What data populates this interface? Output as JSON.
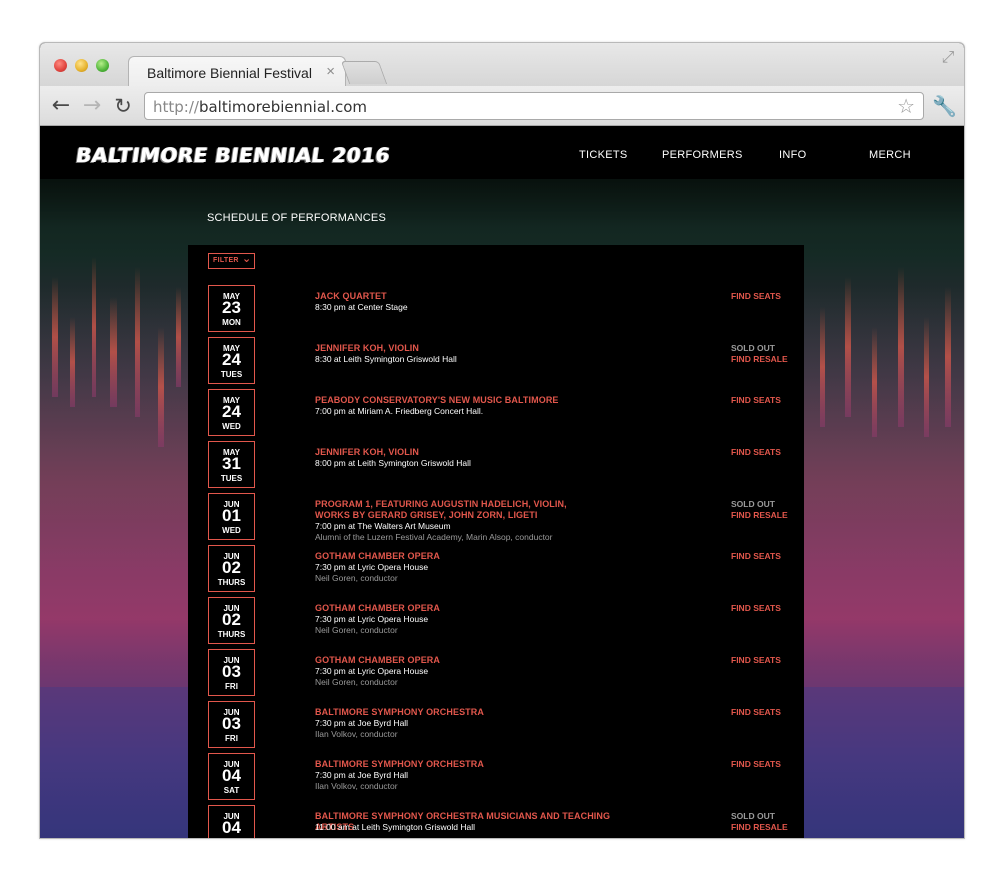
{
  "browser": {
    "tab_title": "Baltimore Biennial Festival",
    "tab_close": "×",
    "url_protocol": "http://",
    "url_host": "baltimorebiennial.com",
    "icons": {
      "back": "←",
      "forward": "→",
      "reload": "↻",
      "star": "☆",
      "wrench": "🔧",
      "resize": "⤢"
    }
  },
  "site": {
    "logo": "BALTIMORE BIENNIAL 2016",
    "nav": [
      "TICKETS",
      "PERFORMERS",
      "INFO",
      "MERCH"
    ],
    "section_title": "SCHEDULE OF PERFORMANCES",
    "filter_label": "FILTER",
    "filter_icon": "⌄"
  },
  "colors": {
    "accent": "#e2574c",
    "muted": "#9a9a9a",
    "background": "#000000"
  },
  "events": [
    {
      "month": "MAY",
      "day": "23",
      "weekday": "MON",
      "title_lines": [
        "JACK QUARTET"
      ],
      "detail": "8:30 pm at Center Stage",
      "conductor": "",
      "status": "",
      "action": "FIND SEATS"
    },
    {
      "month": "MAY",
      "day": "24",
      "weekday": "TUES",
      "title_lines": [
        "JENNIFER KOH, VIOLIN"
      ],
      "detail": "8:30 at Leith Symington Griswold Hall",
      "conductor": "",
      "status": "SOLD OUT",
      "action": "FIND RESALE"
    },
    {
      "month": "MAY",
      "day": "24",
      "weekday": "WED",
      "title_lines": [
        "PEABODY CONSERVATORY'S NEW MUSIC BALTIMORE"
      ],
      "detail": "7:00 pm at Miriam A. Friedberg Concert Hall.",
      "conductor": "",
      "status": "",
      "action": "FIND SEATS"
    },
    {
      "month": "MAY",
      "day": "31",
      "weekday": "TUES",
      "title_lines": [
        "JENNIFER KOH, VIOLIN"
      ],
      "detail": "8:00 pm at Leith Symington Griswold Hall",
      "conductor": "",
      "status": "",
      "action": "FIND SEATS"
    },
    {
      "month": "JUN",
      "day": "01",
      "weekday": "WED",
      "title_lines": [
        "PROGRAM 1, FEATURING AUGUSTIN HADELICH, VIOLIN,",
        "WORKS BY GERARD GRISEY, JOHN ZORN, LIGETI"
      ],
      "detail": "7:00 pm at The Walters Art Museum",
      "conductor": "Alumni of the Luzern Festival Academy, Marin Alsop, conductor",
      "status": "SOLD OUT",
      "action": "FIND RESALE"
    },
    {
      "month": "JUN",
      "day": "02",
      "weekday": "THURS",
      "title_lines": [
        "GOTHAM CHAMBER OPERA"
      ],
      "detail": "7:30 pm at Lyric Opera House",
      "conductor": "Neil Goren, conductor",
      "status": "",
      "action": "FIND SEATS"
    },
    {
      "month": "JUN",
      "day": "02",
      "weekday": "THURS",
      "title_lines": [
        "GOTHAM CHAMBER OPERA"
      ],
      "detail": "7:30 pm at Lyric Opera House",
      "conductor": "Neil Goren, conductor",
      "status": "",
      "action": "FIND SEATS"
    },
    {
      "month": "JUN",
      "day": "03",
      "weekday": "FRI",
      "title_lines": [
        "GOTHAM CHAMBER OPERA"
      ],
      "detail": "7:30 pm at Lyric Opera House",
      "conductor": "Neil Goren, conductor",
      "status": "",
      "action": "FIND SEATS"
    },
    {
      "month": "JUN",
      "day": "03",
      "weekday": "FRI",
      "title_lines": [
        "BALTIMORE SYMPHONY ORCHESTRA"
      ],
      "detail": "7:30 pm at Joe Byrd Hall",
      "conductor": "Ilan Volkov, conductor",
      "status": "",
      "action": "FIND SEATS"
    },
    {
      "month": "JUN",
      "day": "04",
      "weekday": "SAT",
      "title_lines": [
        "BALTIMORE SYMPHONY ORCHESTRA"
      ],
      "detail": "7:30 pm at Joe Byrd Hall",
      "conductor": "Ilan Volkov, conductor",
      "status": "",
      "action": "FIND SEATS"
    },
    {
      "month": "JUN",
      "day": "04",
      "weekday": "",
      "title_lines": [
        "BALTIMORE SYMPHONY ORCHESTRA MUSICIANS AND TEACHING ARTISTS"
      ],
      "detail": "11:00 am at Leith Symington Griswold Hall",
      "conductor": "",
      "status": "SOLD OUT",
      "action": "FIND RESALE"
    }
  ]
}
